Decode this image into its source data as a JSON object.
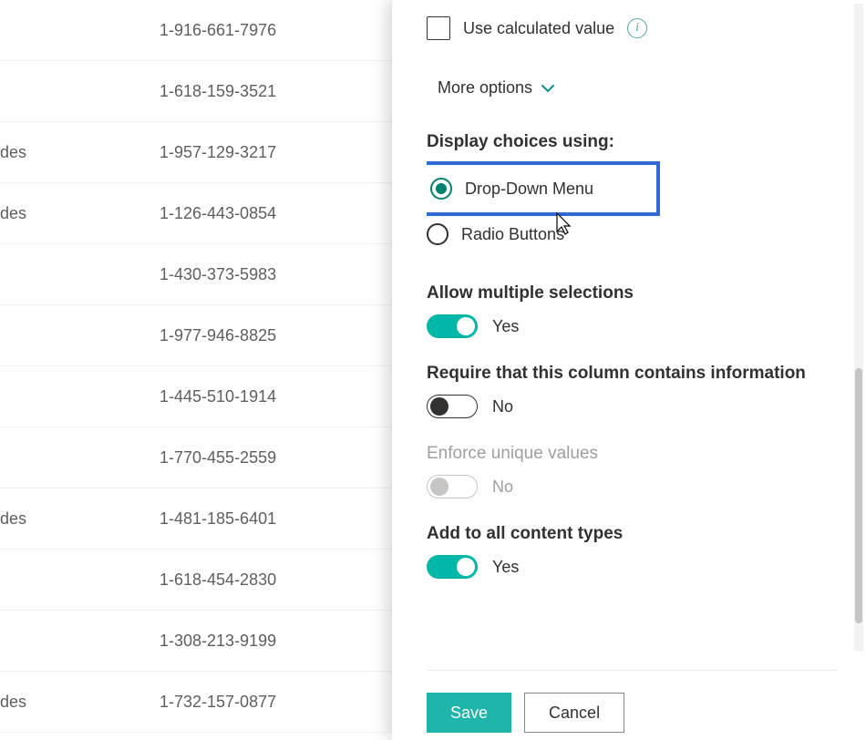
{
  "list": {
    "rows": [
      {
        "a": "",
        "b": "1-916-661-7976"
      },
      {
        "a": "",
        "b": "1-618-159-3521"
      },
      {
        "a": "des",
        "b": "1-957-129-3217"
      },
      {
        "a": "des",
        "b": "1-126-443-0854"
      },
      {
        "a": "",
        "b": "1-430-373-5983"
      },
      {
        "a": "",
        "b": "1-977-946-8825"
      },
      {
        "a": "",
        "b": "1-445-510-1914"
      },
      {
        "a": "",
        "b": "1-770-455-2559"
      },
      {
        "a": "des",
        "b": "1-481-185-6401"
      },
      {
        "a": "",
        "b": "1-618-454-2830"
      },
      {
        "a": "",
        "b": "1-308-213-9199"
      },
      {
        "a": "des",
        "b": "1-732-157-0877"
      }
    ]
  },
  "panel": {
    "use_calc_label": "Use calculated value",
    "more_options": "More options",
    "display_choices_label": "Display choices using:",
    "radio_dropdown": "Drop-Down Menu",
    "radio_radiobuttons": "Radio Buttons",
    "allow_multiple_label": "Allow multiple selections",
    "allow_multiple_value": "Yes",
    "require_label": "Require that this column contains information",
    "require_value": "No",
    "enforce_label": "Enforce unique values",
    "enforce_value": "No",
    "add_all_label": "Add to all content types",
    "add_all_value": "Yes",
    "save": "Save",
    "cancel": "Cancel"
  }
}
